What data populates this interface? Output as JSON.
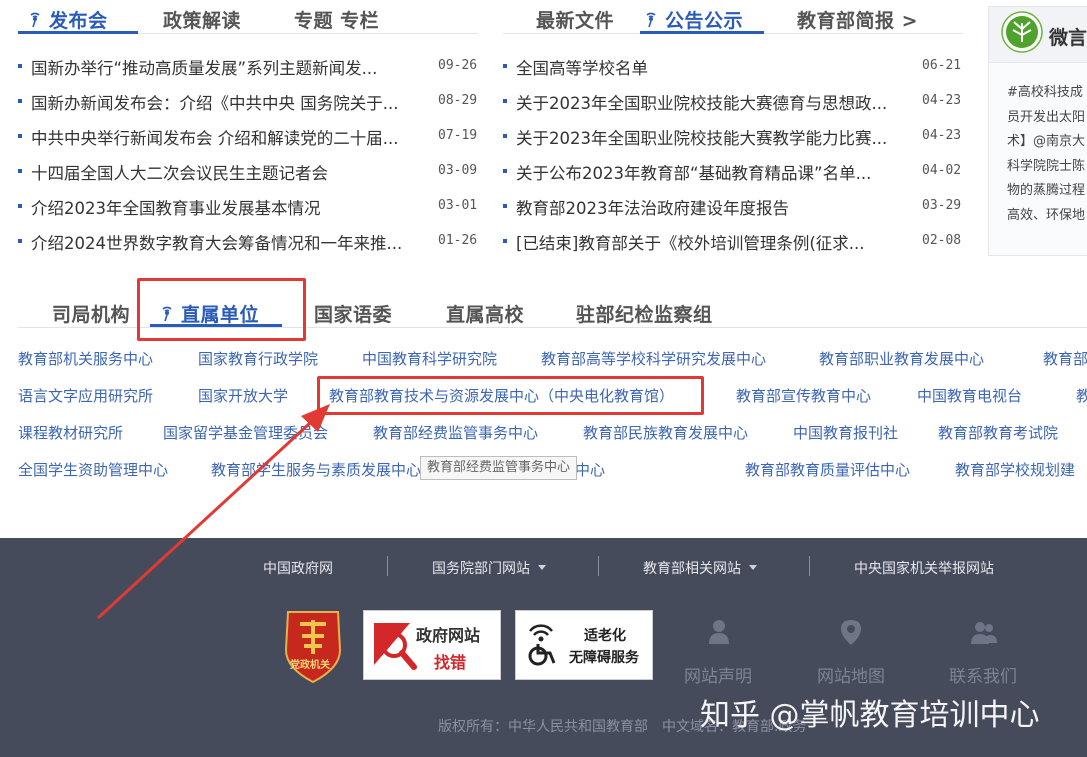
{
  "left_tabs": {
    "items": [
      {
        "label": "发布会",
        "active": true
      },
      {
        "label": "政策解读",
        "active": false
      },
      {
        "label": "专题 专栏",
        "active": false
      }
    ]
  },
  "left_news": [
    {
      "title": "国新办举行“推动高质量发展”系列主题新闻发...",
      "date": "09-26"
    },
    {
      "title": "国新办新闻发布会：介绍《中共中央 国务院关于...",
      "date": "08-29"
    },
    {
      "title": "中共中央举行新闻发布会 介绍和解读党的二十届...",
      "date": "07-19"
    },
    {
      "title": "十四届全国人大二次会议民生主题记者会",
      "date": "03-09"
    },
    {
      "title": "介绍2023年全国教育事业发展基本情况",
      "date": "03-01"
    },
    {
      "title": "介绍2024世界数字教育大会筹备情况和一年来推...",
      "date": "01-26"
    }
  ],
  "mid_tabs": {
    "items": [
      {
        "label": "最新文件",
        "active": false
      },
      {
        "label": "公告公示",
        "active": true
      },
      {
        "label": "教育部简报 >",
        "active": false
      }
    ]
  },
  "mid_news": [
    {
      "title": "全国高等学校名单",
      "date": "06-21"
    },
    {
      "title": "关于2023年全国职业院校技能大赛德育与思想政...",
      "date": "04-23"
    },
    {
      "title": "关于2023年全国职业院校技能大赛教学能力比赛...",
      "date": "04-23"
    },
    {
      "title": "关于公布2023年教育部“基础教育精品课”名单...",
      "date": "04-02"
    },
    {
      "title": "教育部2023年法治政府建设年度报告",
      "date": "03-29"
    },
    {
      "title": "[已结束]教育部关于《校外培训管理条例(征求...",
      "date": "02-08"
    }
  ],
  "weibo": {
    "name": "微言",
    "lines": [
      "#高校科技成",
      "员开发出太阳",
      "术】@南京大",
      "科学院院士陈",
      "物的蒸腾过程",
      "高效、环保地"
    ]
  },
  "unit_tabs": {
    "items": [
      {
        "label": "司局机构",
        "active": false
      },
      {
        "label": "直属单位",
        "active": true
      },
      {
        "label": "国家语委",
        "active": false
      },
      {
        "label": "直属高校",
        "active": false
      },
      {
        "label": "驻部纪检监察组",
        "active": false
      }
    ]
  },
  "units": {
    "row1": [
      "教育部机关服务中心",
      "国家教育行政学院",
      "中国教育科学研究院",
      "教育部高等学校科学研究发展中心",
      "教育部职业教育发展中心",
      "教育部"
    ],
    "row2": [
      "语言文字应用研究所",
      "国家开放大学",
      "教育部教育技术与资源发展中心（中央电化教育馆）",
      "教育部宣传教育中心",
      "中国教育电视台",
      "教"
    ],
    "row3": [
      "课程教材研究所",
      "国家留学基金管理委员会",
      "教育部经费监管事务中心",
      "教育部民族教育发展中心",
      "中国教育报刊社",
      "教育部教育考试院"
    ],
    "row4": [
      "全国学生资助管理中心",
      "教育部学生服务与素质发展中心",
      "教育部教师发展中心",
      "教育部教育质量评估中心",
      "教育部学校规划建"
    ]
  },
  "tooltip": "教育部经费监管事务中心",
  "footer": {
    "nav": [
      "中国政府网",
      "国务院部门网站",
      "教育部相关网站",
      "中央国家机关举报网站"
    ],
    "badges": {
      "party_label": "党政机关",
      "gov_line1": "政府网站",
      "gov_line2": "找错",
      "access_line1": "适老化",
      "access_line2": "无障碍服务"
    },
    "links": [
      "网站声明",
      "网站地图",
      "联系我们"
    ],
    "copyright": "版权所有：中华人民共和国教育部　中文域名：教育部.政务"
  },
  "watermark": "知乎 @掌帆教育培训中心",
  "colors": {
    "accent": "#2a5bb8",
    "link": "#3d66b4",
    "highlight": "#e03a33",
    "footer_bg": "#464b5c"
  }
}
